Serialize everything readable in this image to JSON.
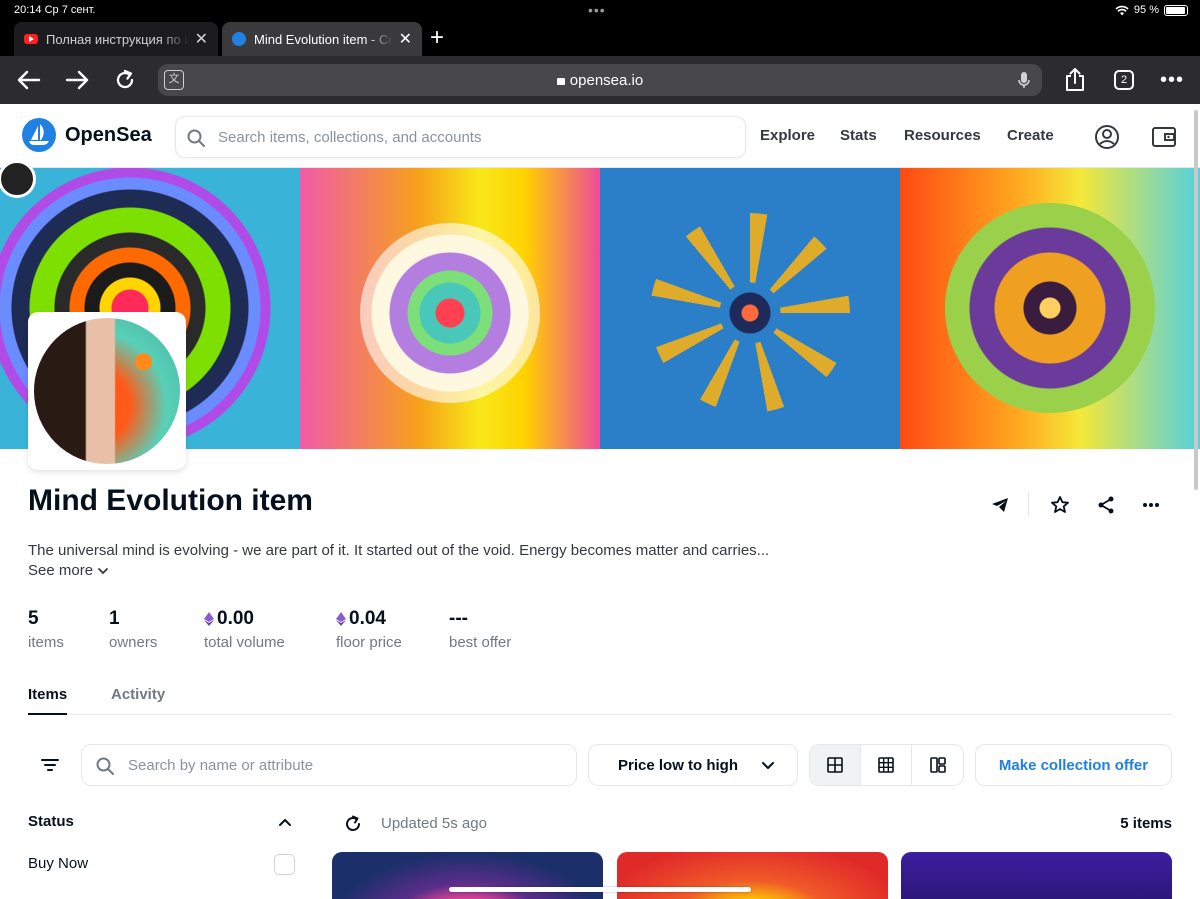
{
  "status_bar": {
    "time": "20:14",
    "date": "Ср 7 сент.",
    "battery": "95 %"
  },
  "tabs": [
    {
      "title": "Полная инструкция по и",
      "active": false
    },
    {
      "title": "Mind Evolution item - Col",
      "active": true
    }
  ],
  "browser": {
    "url": "opensea.io",
    "tab_count": "2"
  },
  "opensea": {
    "brand": "OpenSea",
    "search_placeholder": "Search items, collections, and accounts",
    "nav": [
      "Explore",
      "Stats",
      "Resources",
      "Create"
    ]
  },
  "collection": {
    "title": "Mind Evolution item",
    "description": "The universal mind is evolving - we are part of it. It started out of the void. Energy becomes matter and carries...",
    "see_more": "See more",
    "stats": [
      {
        "value": "5",
        "label": "items",
        "eth": false
      },
      {
        "value": "1",
        "label": "owners",
        "eth": false
      },
      {
        "value": "0.00",
        "label": "total volume",
        "eth": true
      },
      {
        "value": "0.04",
        "label": "floor price",
        "eth": true
      },
      {
        "value": "---",
        "label": "best offer",
        "eth": false
      }
    ],
    "tabs": [
      "Items",
      "Activity"
    ]
  },
  "toolbar": {
    "filter_placeholder": "Search by name or attribute",
    "sort": "Price low to high",
    "offer_button": "Make collection offer"
  },
  "sidebar": {
    "status_label": "Status",
    "buy_now": "Buy Now"
  },
  "results": {
    "updated": "Updated 5s ago",
    "count": "5 items"
  },
  "colors": {
    "accent": "#2081e2",
    "text": "#04111d",
    "muted": "#707a83",
    "border": "#e5e8eb"
  }
}
